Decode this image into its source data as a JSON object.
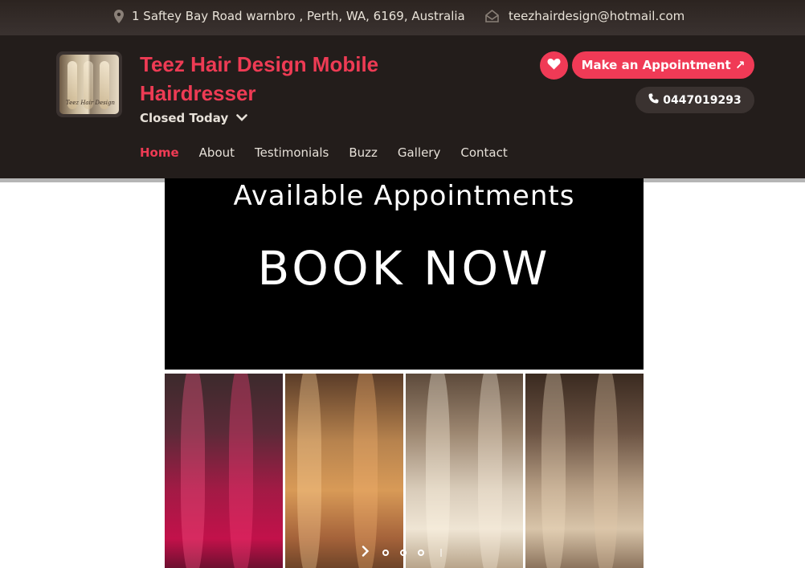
{
  "topbar": {
    "address": "1 Saftey Bay Road warnbro , Perth, WA, 6169, Australia",
    "email": "teezhairdesign@hotmail.com"
  },
  "header": {
    "title": "Teez Hair Design Mobile Hairdresser",
    "status": "Closed Today",
    "appointment_label": "Make an Appointment ↗",
    "phone": "0447019293",
    "logo_script": "Teez Hair Design"
  },
  "nav": {
    "items": [
      {
        "label": "Home"
      },
      {
        "label": "About"
      },
      {
        "label": "Testimonials"
      },
      {
        "label": "Buzz"
      },
      {
        "label": "Gallery"
      },
      {
        "label": "Contact"
      }
    ]
  },
  "slider": {
    "line1": "Available Appointments",
    "line2": "BOOK NOW",
    "photos": [
      "magenta",
      "copper",
      "blonde",
      "ash"
    ]
  },
  "colors": {
    "accent": "#ee3b54",
    "dark": "#231d1b"
  }
}
